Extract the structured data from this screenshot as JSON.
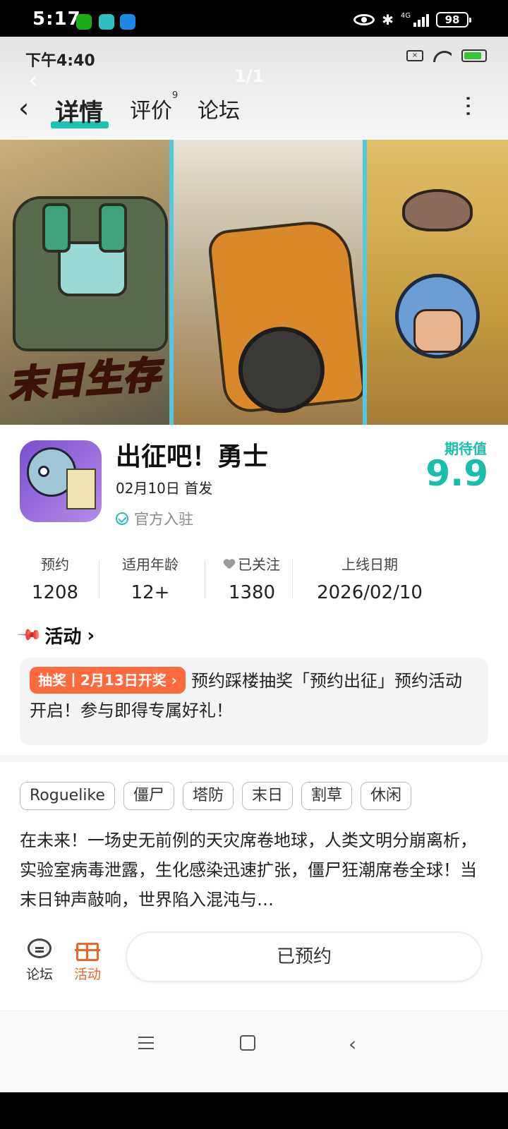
{
  "system_status": {
    "time": "5:17",
    "network": "4G",
    "battery": "98"
  },
  "app_status": {
    "time": "下午4:40"
  },
  "ghost_header": {
    "page_counter": "1/1"
  },
  "header": {
    "back": "‹",
    "tabs": [
      {
        "label": "详情",
        "active": true
      },
      {
        "label": "评价",
        "badge": "9"
      },
      {
        "label": "论坛"
      }
    ],
    "more": "⋮"
  },
  "banner": {
    "title": "末日生存"
  },
  "game": {
    "name": "出征吧！勇士",
    "release": "02月10日 首发",
    "official": "官方入驻",
    "expect_label": "期待值",
    "expect_value": "9.9"
  },
  "stats": [
    {
      "label": "预约",
      "value": "1208"
    },
    {
      "label": "适用年龄",
      "value": "12+"
    },
    {
      "label": "已关注",
      "value": "1380"
    },
    {
      "label": "上线日期",
      "value": "2026/02/10"
    }
  ],
  "activity": {
    "heading": "活动",
    "tag": "抽奖丨2月13日开奖",
    "text": "预约踩楼抽奖「预约出征」预约活动开启！参与即得专属好礼！"
  },
  "tags": [
    "Roguelike",
    "僵尸",
    "塔防",
    "末日",
    "割草",
    "休闲"
  ],
  "description": "在未来！一场史无前例的天灾席卷地球，人类文明分崩离析，实验室病毒泄露，生化感染迅速扩张，僵尸狂潮席卷全球！当末日钟声敲响，世界陷入混沌与…",
  "bottom_bar": {
    "forum_label": "论坛",
    "activity_label": "活动",
    "reserved_label": "已预约"
  },
  "colors": {
    "accent": "#17bfa8",
    "activity_tag": "#ff6a3d",
    "activity_icon": "#f0642a"
  }
}
